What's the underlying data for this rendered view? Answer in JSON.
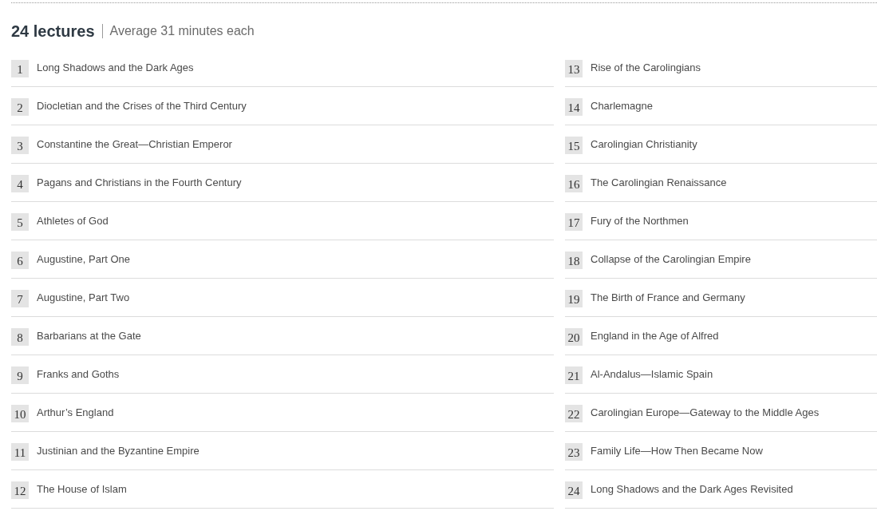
{
  "header": {
    "count": "24 lectures",
    "average": "Average 31 minutes each"
  },
  "lectures": [
    {
      "number": "1",
      "title": "Long Shadows and the Dark Ages"
    },
    {
      "number": "2",
      "title": "Diocletian and the Crises of the Third Century"
    },
    {
      "number": "3",
      "title": "Constantine the Great—Christian Emperor"
    },
    {
      "number": "4",
      "title": "Pagans and Christians in the Fourth Century"
    },
    {
      "number": "5",
      "title": "Athletes of God"
    },
    {
      "number": "6",
      "title": "Augustine, Part One"
    },
    {
      "number": "7",
      "title": "Augustine, Part Two"
    },
    {
      "number": "8",
      "title": "Barbarians at the Gate"
    },
    {
      "number": "9",
      "title": "Franks and Goths"
    },
    {
      "number": "10",
      "title": "Arthur’s England"
    },
    {
      "number": "11",
      "title": "Justinian and the Byzantine Empire"
    },
    {
      "number": "12",
      "title": "The House of Islam"
    },
    {
      "number": "13",
      "title": "Rise of the Carolingians"
    },
    {
      "number": "14",
      "title": "Charlemagne"
    },
    {
      "number": "15",
      "title": "Carolingian Christianity"
    },
    {
      "number": "16",
      "title": "The Carolingian Renaissance"
    },
    {
      "number": "17",
      "title": "Fury of the Northmen"
    },
    {
      "number": "18",
      "title": "Collapse of the Carolingian Empire"
    },
    {
      "number": "19",
      "title": "The Birth of France and Germany"
    },
    {
      "number": "20",
      "title": "England in the Age of Alfred"
    },
    {
      "number": "21",
      "title": "Al-Andalus—Islamic Spain"
    },
    {
      "number": "22",
      "title": "Carolingian Europe—Gateway to the Middle Ages"
    },
    {
      "number": "23",
      "title": "Family Life—How Then Became Now"
    },
    {
      "number": "24",
      "title": "Long Shadows and the Dark Ages Revisited"
    }
  ]
}
